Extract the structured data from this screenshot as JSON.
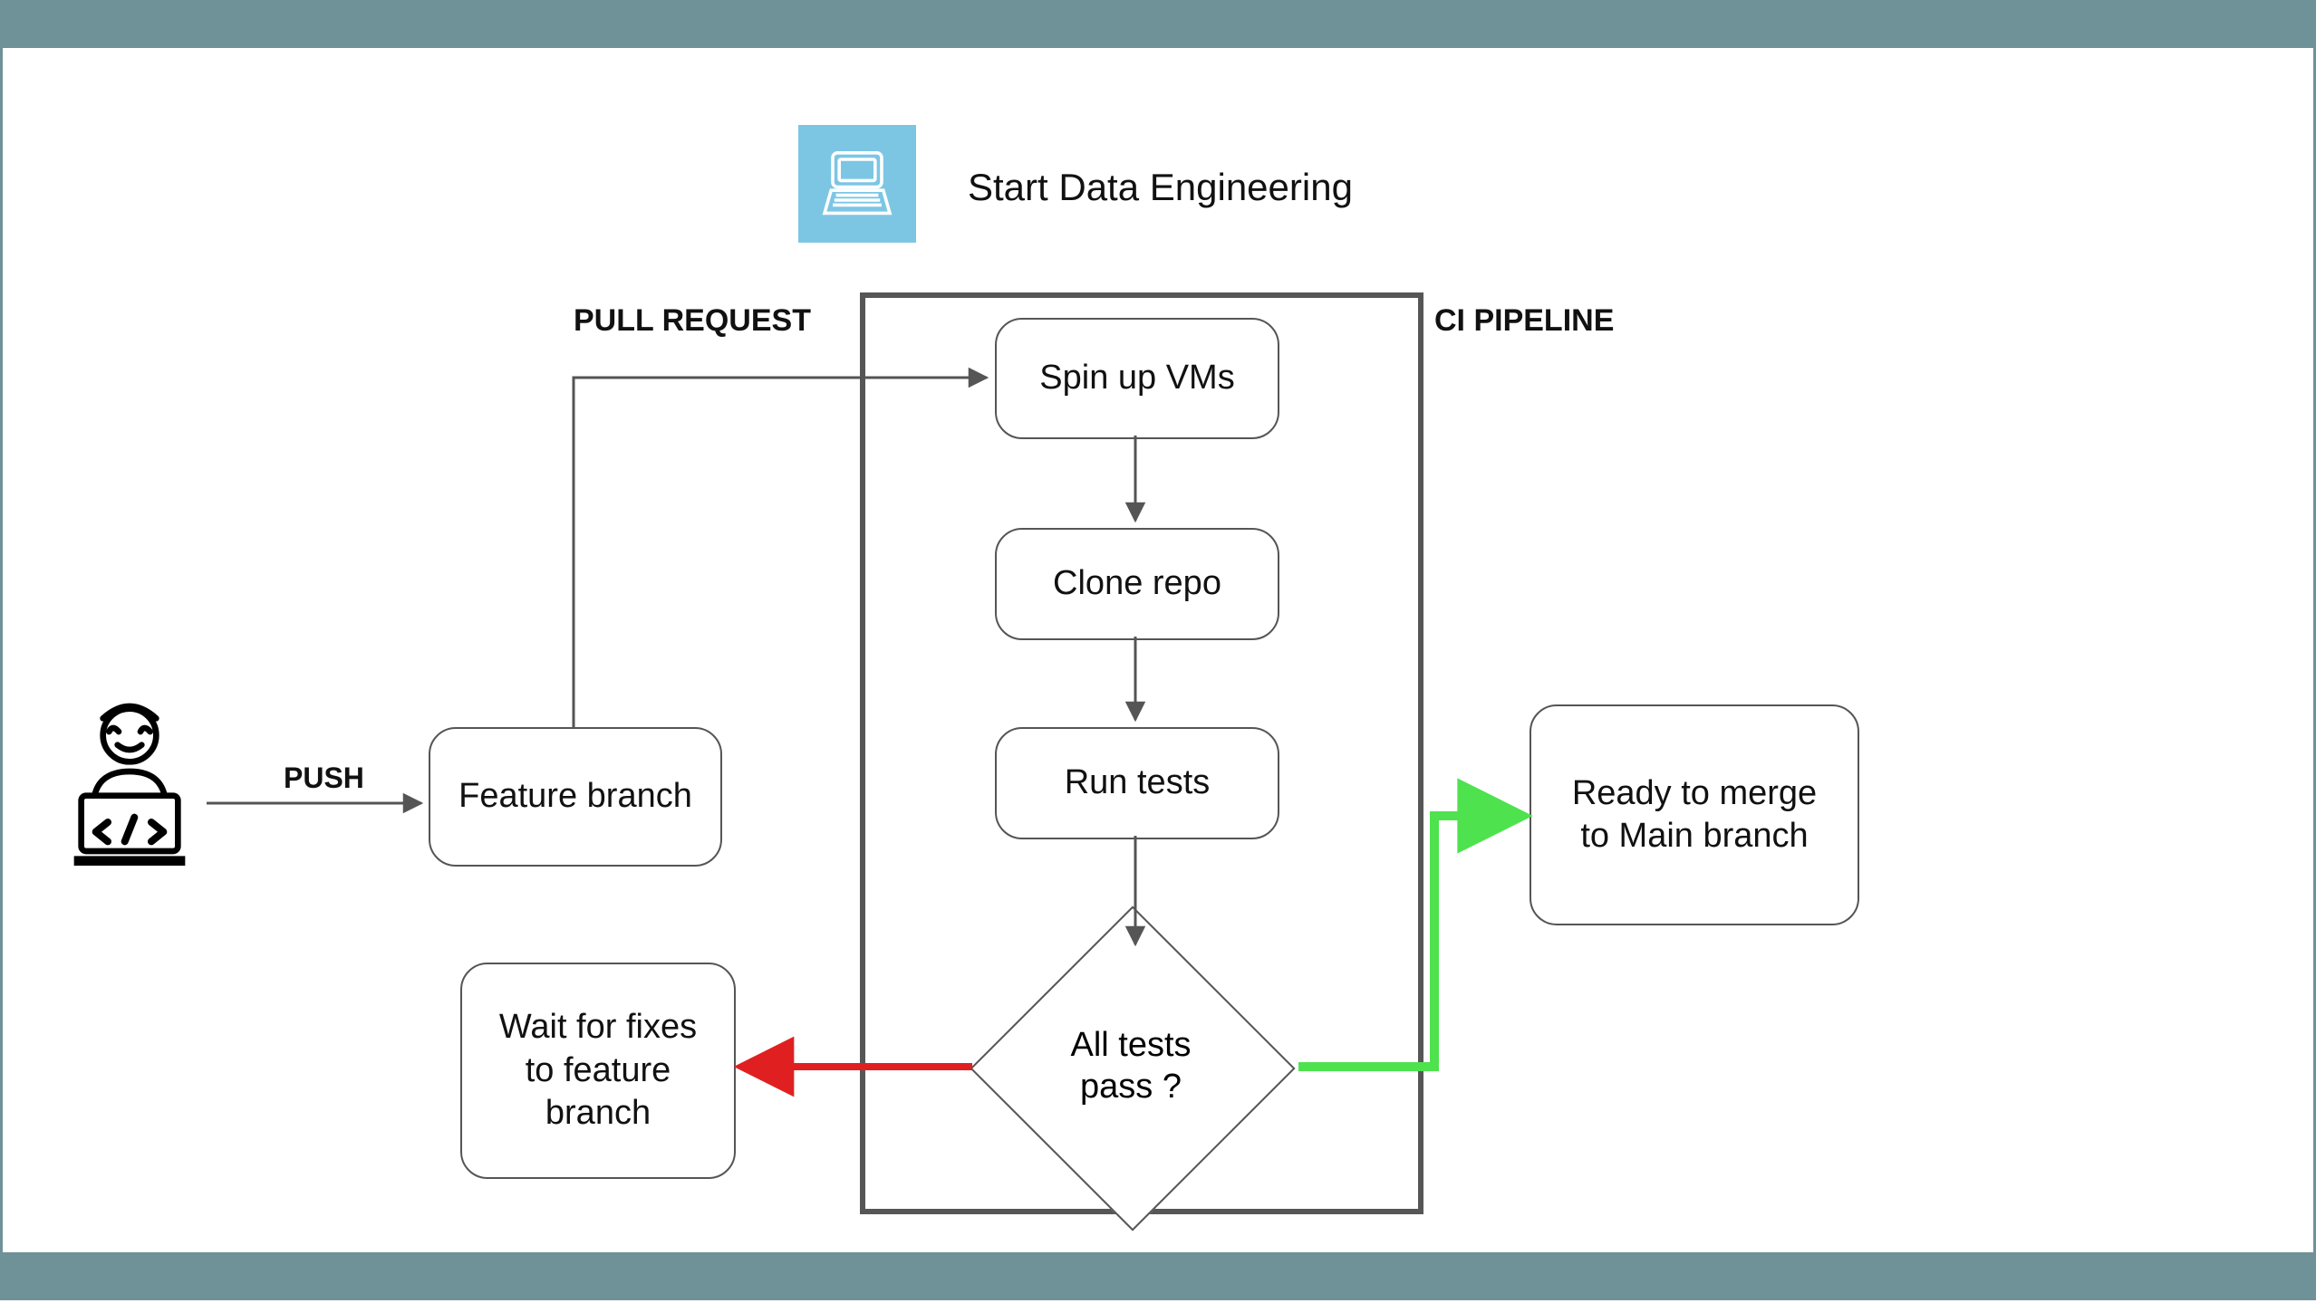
{
  "header": {
    "title": "Start Data Engineering"
  },
  "labels": {
    "push": "PUSH",
    "pull_request": "PULL REQUEST",
    "ci_pipeline": "CI PIPELINE"
  },
  "nodes": {
    "feature_branch": "Feature branch",
    "spin_up_vms": "Spin up VMs",
    "clone_repo": "Clone repo",
    "run_tests": "Run tests",
    "decision": "All tests pass ?",
    "wait_fixes": "Wait for fixes to feature branch",
    "ready_merge": "Ready to merge to Main branch"
  },
  "icons": {
    "dev": "developer-icon",
    "laptop": "laptop-icon"
  },
  "colors": {
    "bar": "#6f9198",
    "logo": "#7cc6e4",
    "arrow": "#555555",
    "pass": "#4fe24f",
    "fail": "#e02020"
  }
}
